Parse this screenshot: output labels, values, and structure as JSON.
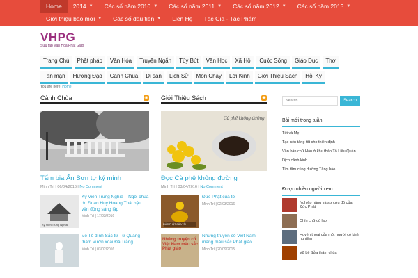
{
  "topnav": {
    "items": [
      {
        "label": "Home",
        "caret": false
      },
      {
        "label": "2014",
        "caret": true
      },
      {
        "label": "Các số năm 2010",
        "caret": true
      },
      {
        "label": "Các số năm 2011",
        "caret": true
      },
      {
        "label": "Các số năm 2012",
        "caret": true
      },
      {
        "label": "Các số năm 2013",
        "caret": true
      },
      {
        "label": "Giới thiệu báo mới",
        "caret": true
      },
      {
        "label": "Các số đầu tiên",
        "caret": true
      },
      {
        "label": "Liên Hệ",
        "caret": false
      },
      {
        "label": "Tác Giả - Tác Phẩm",
        "caret": false
      }
    ]
  },
  "site": {
    "logo": "VHPG",
    "tagline": "Sưu tập Văn Hoá Phật Giáo"
  },
  "catnav": {
    "row1": [
      "Trang Chủ",
      "Phật pháp",
      "Văn Hóa",
      "Truyện Ngắn",
      "Tùy Bút",
      "Văn Học",
      "Xã Hội",
      "Cuộc Sống",
      "Giáo Dục",
      "Thơ"
    ],
    "row2": [
      "Tản mạn",
      "Hương Đạo",
      "Cảnh Chùa",
      "Di sản",
      "Lịch Sử",
      "Môn Chay",
      "Lời Kinh",
      "Giới Thiệu Sách",
      "Hỏi Ký"
    ]
  },
  "breadcrumb": {
    "prefix": "You are here:",
    "home": "Home"
  },
  "left": {
    "title": "Cảnh Chùa",
    "featured": {
      "title": "Tấm bia Ấn Sơn tự ký minh",
      "author": "Minh Trí",
      "date": "06/04/2016",
      "comments": "No Comment"
    },
    "items": [
      {
        "title": "Kỳ Viên Trung Nghĩa – Ngôi chùa do Đoan Huy Hoàng Thái hậu vận động sáng lập",
        "author": "Minh Trí",
        "date": "17/03/2016"
      },
      {
        "title": "Về Tổ đình Sắc tứ Từ Quang thăm vườn xoài Đá Trắng",
        "author": "Minh Trí",
        "date": "03/02/2016"
      }
    ],
    "thumb1_caption": "Kỳ Viên Trung Nghĩa"
  },
  "middle": {
    "title": "Giới Thiệu Sách",
    "featured": {
      "title": "Đọc Cà phê không đường",
      "author": "Minh Trí",
      "date": "03/04/2016",
      "comments": "No Comment",
      "image_caption": "Cà phê không đường"
    },
    "items": [
      {
        "title": "Đức Phật của tôi",
        "author": "Minh Trí",
        "date": "02/03/2016",
        "thumb_caption": "ĐỨC PHẬT CỦA TÔI"
      },
      {
        "title": "Những truyện cổ Việt Nam mang màu sắc Phật giáo",
        "author": "Minh Trí",
        "date": "20/09/2015",
        "thumb_caption": "Những truyện cổ Việt Nam màu sắc Phật giáo"
      }
    ]
  },
  "sidebar": {
    "search_placeholder": "Search ...",
    "search_button": "Search",
    "latest_title": "Bài mới trong tuần",
    "latest_items": [
      "Tết và Mẹ",
      "Tạo nền tảng tốt cho thiền định",
      "Văn bản chữ Hán ở khu tháp Tổ Liễu Quán",
      "Dịch cảnh kinh",
      "Tìm tâm cùng dường Tăng bảo"
    ],
    "popular_title": "Được nhiều người xem",
    "popular_items": [
      "Nghiệp nặng và sự cứu độ của Đức Phật",
      "Chín chữ cù lao",
      "Huyền thoại của một người có kinh nghiệm",
      "Vũ Lê Sửa thăm chùa"
    ]
  },
  "colors": {
    "topnav_bg": "#e74c3c",
    "accent": "#3ab6d6",
    "link": "#2aa7cf",
    "logo": "#9b2f7e"
  }
}
